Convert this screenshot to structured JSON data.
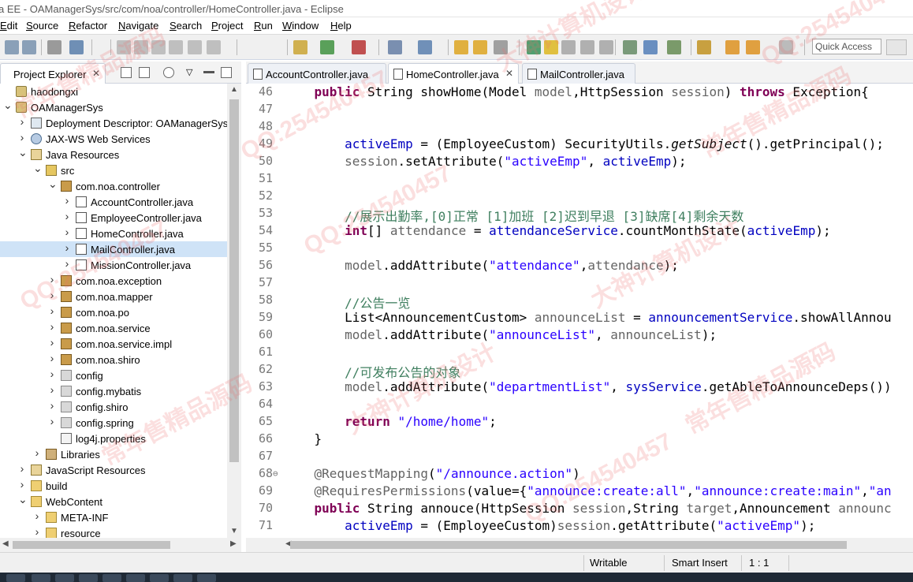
{
  "window": {
    "title": "a EE - OAManagerSys/src/com/noa/controller/HomeController.java - Eclipse"
  },
  "menu": {
    "items": [
      "Edit",
      "Source",
      "Refactor",
      "Navigate",
      "Search",
      "Project",
      "Run",
      "Window",
      "Help"
    ]
  },
  "toolbar": {
    "quick_access_placeholder": "Quick Access"
  },
  "project_explorer": {
    "tab_label": "Project Explorer",
    "tree": [
      {
        "label": "haodongxi",
        "depth": 0,
        "icon": "project-icon",
        "twisty": ""
      },
      {
        "label": "OAManagerSys",
        "depth": 0,
        "icon": "project-icon",
        "twisty": "open"
      },
      {
        "label": "Deployment Descriptor: OAManagerSys",
        "depth": 1,
        "icon": "deployment-descriptor-icon",
        "twisty": "closed"
      },
      {
        "label": "JAX-WS Web Services",
        "depth": 1,
        "icon": "web-services-icon",
        "twisty": "closed"
      },
      {
        "label": "Java Resources",
        "depth": 1,
        "icon": "java-resources-icon",
        "twisty": "open"
      },
      {
        "label": "src",
        "depth": 2,
        "icon": "source-folder-icon",
        "twisty": "open"
      },
      {
        "label": "com.noa.controller",
        "depth": 3,
        "icon": "package-icon",
        "twisty": "open"
      },
      {
        "label": "AccountController.java",
        "depth": 4,
        "icon": "java-file-icon",
        "twisty": "closed"
      },
      {
        "label": "EmployeeController.java",
        "depth": 4,
        "icon": "java-file-icon",
        "twisty": "closed"
      },
      {
        "label": "HomeController.java",
        "depth": 4,
        "icon": "java-file-icon",
        "twisty": "closed"
      },
      {
        "label": "MailController.java",
        "depth": 4,
        "icon": "java-file-icon",
        "twisty": "closed",
        "selected": true
      },
      {
        "label": "MissionController.java",
        "depth": 4,
        "icon": "java-file-icon",
        "twisty": "closed"
      },
      {
        "label": "com.noa.exception",
        "depth": 3,
        "icon": "package-icon",
        "twisty": "closed"
      },
      {
        "label": "com.noa.mapper",
        "depth": 3,
        "icon": "package-icon",
        "twisty": "closed"
      },
      {
        "label": "com.noa.po",
        "depth": 3,
        "icon": "package-icon",
        "twisty": "closed"
      },
      {
        "label": "com.noa.service",
        "depth": 3,
        "icon": "package-icon",
        "twisty": "closed"
      },
      {
        "label": "com.noa.service.impl",
        "depth": 3,
        "icon": "package-icon",
        "twisty": "closed"
      },
      {
        "label": "com.noa.shiro",
        "depth": 3,
        "icon": "package-icon",
        "twisty": "closed"
      },
      {
        "label": "config",
        "depth": 3,
        "icon": "config-package-icon",
        "twisty": "closed"
      },
      {
        "label": "config.mybatis",
        "depth": 3,
        "icon": "config-package-icon",
        "twisty": "closed"
      },
      {
        "label": "config.shiro",
        "depth": 3,
        "icon": "config-package-icon",
        "twisty": "closed"
      },
      {
        "label": "config.spring",
        "depth": 3,
        "icon": "config-package-icon",
        "twisty": "closed"
      },
      {
        "label": "log4j.properties",
        "depth": 3,
        "icon": "properties-file-icon",
        "twisty": ""
      },
      {
        "label": "Libraries",
        "depth": 2,
        "icon": "libraries-icon",
        "twisty": "closed"
      },
      {
        "label": "JavaScript Resources",
        "depth": 1,
        "icon": "javascript-resources-icon",
        "twisty": "closed"
      },
      {
        "label": "build",
        "depth": 1,
        "icon": "folder-icon",
        "twisty": "closed"
      },
      {
        "label": "WebContent",
        "depth": 1,
        "icon": "folder-icon",
        "twisty": "open"
      },
      {
        "label": "META-INF",
        "depth": 2,
        "icon": "folder-icon",
        "twisty": "closed"
      },
      {
        "label": "resource",
        "depth": 2,
        "icon": "folder-icon",
        "twisty": "closed"
      }
    ]
  },
  "editor": {
    "tabs": [
      {
        "label": "AccountController.java",
        "active": false
      },
      {
        "label": "HomeController.java",
        "active": true
      },
      {
        "label": "MailController.java",
        "active": false
      }
    ],
    "lines": [
      {
        "n": "46",
        "fold": "",
        "segs": [
          [
            "    ",
            ""
          ],
          [
            "public",
            "kw"
          ],
          [
            " String showHome(Model ",
            ""
          ],
          [
            "model",
            "ann"
          ],
          [
            ",HttpSession ",
            ""
          ],
          [
            "session",
            "ann"
          ],
          [
            ") ",
            ""
          ],
          [
            "throws",
            "kw"
          ],
          [
            " Exception{",
            ""
          ]
        ]
      },
      {
        "n": "47",
        "fold": "",
        "segs": []
      },
      {
        "n": "48",
        "fold": "",
        "segs": []
      },
      {
        "n": "49",
        "fold": "",
        "segs": [
          [
            "        ",
            ""
          ],
          [
            "activeEmp",
            "fld"
          ],
          [
            " = (EmployeeCustom) SecurityUtils.",
            ""
          ],
          [
            "getSubject",
            "it"
          ],
          [
            "().getPrincipal();",
            ""
          ]
        ]
      },
      {
        "n": "50",
        "fold": "",
        "segs": [
          [
            "        ",
            ""
          ],
          [
            "session",
            "ann"
          ],
          [
            ".setAttribute(",
            ""
          ],
          [
            "\"activeEmp\"",
            "str"
          ],
          [
            ", ",
            ""
          ],
          [
            "activeEmp",
            "fld"
          ],
          [
            ");",
            ""
          ]
        ]
      },
      {
        "n": "51",
        "fold": "",
        "segs": []
      },
      {
        "n": "52",
        "fold": "",
        "segs": []
      },
      {
        "n": "53",
        "fold": "",
        "segs": [
          [
            "        ",
            ""
          ],
          [
            "//展示出勤率,[0]正常 [1]加班 [2]迟到早退 [3]缺席[4]剩余天数",
            "com"
          ]
        ]
      },
      {
        "n": "54",
        "fold": "",
        "segs": [
          [
            "        ",
            ""
          ],
          [
            "int",
            "kw"
          ],
          [
            "[] ",
            ""
          ],
          [
            "attendance",
            "ann"
          ],
          [
            " = ",
            ""
          ],
          [
            "attendanceService",
            "fld"
          ],
          [
            ".countMonthState(",
            ""
          ],
          [
            "activeEmp",
            "fld"
          ],
          [
            ");",
            ""
          ]
        ]
      },
      {
        "n": "55",
        "fold": "",
        "segs": []
      },
      {
        "n": "56",
        "fold": "",
        "segs": [
          [
            "        ",
            ""
          ],
          [
            "model",
            "ann"
          ],
          [
            ".addAttribute(",
            ""
          ],
          [
            "\"attendance\"",
            "str"
          ],
          [
            ",",
            ""
          ],
          [
            "attendance",
            "ann"
          ],
          [
            ");",
            ""
          ]
        ]
      },
      {
        "n": "57",
        "fold": "",
        "segs": []
      },
      {
        "n": "58",
        "fold": "",
        "segs": [
          [
            "        ",
            ""
          ],
          [
            "//公告一览",
            "com"
          ]
        ]
      },
      {
        "n": "59",
        "fold": "",
        "segs": [
          [
            "        List<AnnouncementCustom> ",
            ""
          ],
          [
            "announceList",
            "ann"
          ],
          [
            " = ",
            ""
          ],
          [
            "announcementService",
            "fld"
          ],
          [
            ".showAllAnnou",
            ""
          ]
        ]
      },
      {
        "n": "60",
        "fold": "",
        "segs": [
          [
            "        ",
            ""
          ],
          [
            "model",
            "ann"
          ],
          [
            ".addAttribute(",
            ""
          ],
          [
            "\"announceList\"",
            "str"
          ],
          [
            ", ",
            ""
          ],
          [
            "announceList",
            "ann"
          ],
          [
            ");",
            ""
          ]
        ]
      },
      {
        "n": "61",
        "fold": "",
        "segs": []
      },
      {
        "n": "62",
        "fold": "",
        "segs": [
          [
            "        ",
            ""
          ],
          [
            "//可发布公告的对象",
            "com"
          ]
        ]
      },
      {
        "n": "63",
        "fold": "",
        "segs": [
          [
            "        ",
            ""
          ],
          [
            "model",
            "ann"
          ],
          [
            ".addAttribute(",
            ""
          ],
          [
            "\"departmentList\"",
            "str"
          ],
          [
            ", ",
            ""
          ],
          [
            "sysService",
            "fld"
          ],
          [
            ".getAbleToAnnounceDeps())",
            ""
          ]
        ]
      },
      {
        "n": "64",
        "fold": "",
        "segs": []
      },
      {
        "n": "65",
        "fold": "",
        "segs": [
          [
            "        ",
            ""
          ],
          [
            "return",
            "kw"
          ],
          [
            " ",
            ""
          ],
          [
            "\"/home/home\"",
            "str"
          ],
          [
            ";",
            ""
          ]
        ]
      },
      {
        "n": "66",
        "fold": "",
        "segs": [
          [
            "    }",
            ""
          ]
        ]
      },
      {
        "n": "67",
        "fold": "",
        "segs": []
      },
      {
        "n": "68",
        "fold": "⊖",
        "segs": [
          [
            "    ",
            ""
          ],
          [
            "@RequestMapping",
            "ann"
          ],
          [
            "(",
            ""
          ],
          [
            "\"/announce.action\"",
            "str"
          ],
          [
            ")",
            ""
          ]
        ]
      },
      {
        "n": "69",
        "fold": "",
        "segs": [
          [
            "    ",
            ""
          ],
          [
            "@RequiresPermissions",
            "ann"
          ],
          [
            "(value={",
            ""
          ],
          [
            "\"announce:create:all\"",
            "str"
          ],
          [
            ",",
            ""
          ],
          [
            "\"announce:create:main\"",
            "str"
          ],
          [
            ",",
            ""
          ],
          [
            "\"an",
            "str"
          ]
        ]
      },
      {
        "n": "70",
        "fold": "",
        "segs": [
          [
            "    ",
            ""
          ],
          [
            "public",
            "kw"
          ],
          [
            " String annouce(HttpSession ",
            ""
          ],
          [
            "session",
            "ann"
          ],
          [
            ",String ",
            ""
          ],
          [
            "target",
            "ann"
          ],
          [
            ",Announcement ",
            ""
          ],
          [
            "announc",
            "ann"
          ]
        ]
      },
      {
        "n": "71",
        "fold": "",
        "segs": [
          [
            "        ",
            ""
          ],
          [
            "activeEmp",
            "fld"
          ],
          [
            " = (EmployeeCustom)",
            ""
          ],
          [
            "session",
            "ann"
          ],
          [
            ".getAttribute(",
            ""
          ],
          [
            "\"activeEmp\"",
            "str"
          ],
          [
            ");",
            ""
          ]
        ]
      }
    ]
  },
  "status": {
    "writable": "Writable",
    "insert_mode": "Smart Insert",
    "position": "1 : 1"
  },
  "watermark": {
    "items": [
      "常年售精品源码",
      "QQ:254540457",
      "大神计算机设计",
      "常年售精品源码",
      "QQ:254540457",
      "大神计算机设计",
      "QQ:254540457",
      "常年售精品源码",
      "大神计算机设计",
      "QQ:254540457",
      "常年售精品源码",
      "QQ:254540457"
    ]
  }
}
